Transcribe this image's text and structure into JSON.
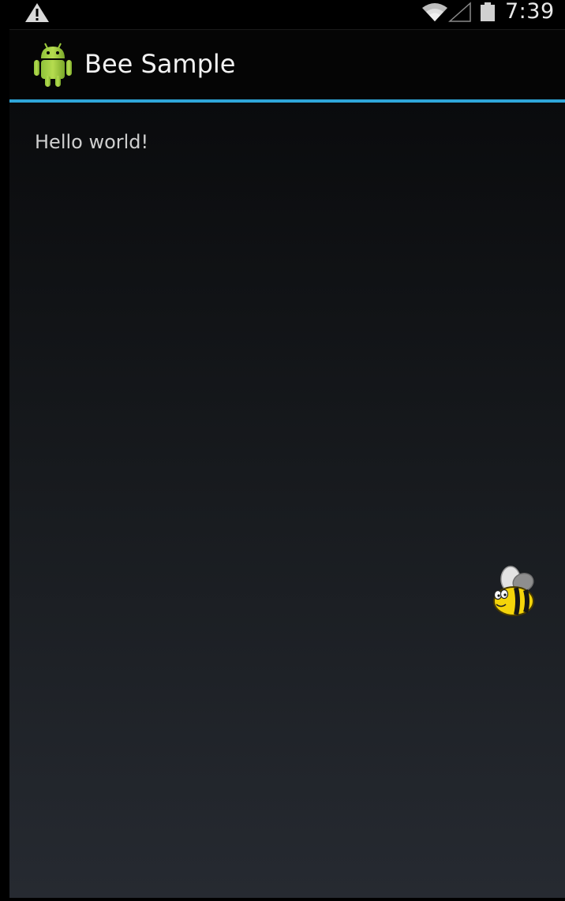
{
  "status_bar": {
    "time": "7:39",
    "icons": {
      "warning": "warning-icon",
      "wifi": "wifi-icon",
      "signal": "signal-icon",
      "battery": "battery-icon"
    }
  },
  "action_bar": {
    "icon": "android-icon",
    "title": "Bee Sample",
    "accent_color": "#2fa6d9"
  },
  "content": {
    "text": "Hello world!",
    "sprite": "bee-icon"
  }
}
